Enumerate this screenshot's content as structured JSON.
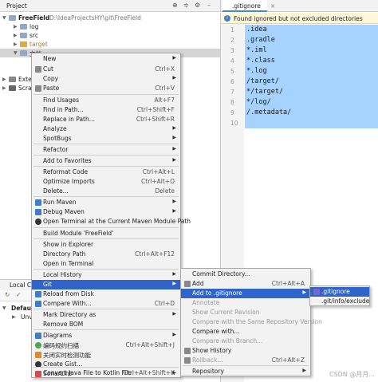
{
  "project_panel": {
    "title": "Project",
    "tree": [
      {
        "label": "FreeField",
        "path": "D:\\IdeaProjectsHY\\git\\FreeField"
      },
      {
        "label": "log"
      },
      {
        "label": "src"
      },
      {
        "label": "target"
      },
      {
        "label": "文档"
      },
      {
        "label": "Exte"
      },
      {
        "label": "Scra"
      }
    ]
  },
  "editor": {
    "tab_label": ".gitignore",
    "notice": "Found ignored but not excluded directories",
    "line_numbers": [
      "1",
      "2",
      "3",
      "4",
      "5",
      "6",
      "7",
      "8",
      "9",
      "10"
    ],
    "lines": [
      ".idea",
      ".gradle",
      "*.iml",
      "*.class",
      "*.log",
      "/target/",
      "*/target/",
      "*/log/",
      "/.metadata/",
      ""
    ]
  },
  "bottom_panel": {
    "tab": "Local Ch",
    "default_label": "Defaul",
    "unversioned": "Unv"
  },
  "context_menu": {
    "items": [
      {
        "label": "New",
        "shortcut": "",
        "submenu": true
      },
      {
        "label": "Cut",
        "shortcut": "Ctrl+X"
      },
      {
        "label": "Copy",
        "shortcut": "",
        "submenu": true
      },
      {
        "label": "Paste",
        "shortcut": "Ctrl+V"
      },
      {
        "label": "Find Usages",
        "shortcut": "Alt+F7"
      },
      {
        "label": "Find in Path...",
        "shortcut": "Ctrl+Shift+F"
      },
      {
        "label": "Replace in Path...",
        "shortcut": "Ctrl+Shift+R"
      },
      {
        "label": "Analyze",
        "shortcut": "",
        "submenu": true
      },
      {
        "label": "SpotBugs",
        "shortcut": "",
        "submenu": true
      },
      {
        "label": "Refactor",
        "shortcut": "",
        "submenu": true
      },
      {
        "label": "Add to Favorites",
        "shortcut": "",
        "submenu": true
      },
      {
        "label": "Reformat Code",
        "shortcut": "Ctrl+Alt+L"
      },
      {
        "label": "Optimize Imports",
        "shortcut": "Ctrl+Alt+O"
      },
      {
        "label": "Delete...",
        "shortcut": "Delete"
      },
      {
        "label": "Run Maven",
        "shortcut": "",
        "submenu": true
      },
      {
        "label": "Debug Maven",
        "shortcut": "",
        "submenu": true
      },
      {
        "label": "Open Terminal at the Current Maven Module Path",
        "shortcut": ""
      },
      {
        "label": "Build Module 'FreeField'",
        "shortcut": ""
      },
      {
        "label": "Show in Explorer",
        "shortcut": ""
      },
      {
        "label": "Directory Path",
        "shortcut": "Ctrl+Alt+F12"
      },
      {
        "label": "Open in Terminal",
        "shortcut": ""
      },
      {
        "label": "Local History",
        "shortcut": "",
        "submenu": true
      },
      {
        "label": "Git",
        "shortcut": "",
        "submenu": true
      },
      {
        "label": "Reload from Disk",
        "shortcut": ""
      },
      {
        "label": "Compare With...",
        "shortcut": "Ctrl+D"
      },
      {
        "label": "Mark Directory as",
        "shortcut": "",
        "submenu": true
      },
      {
        "label": "Remove BOM",
        "shortcut": ""
      },
      {
        "label": "Diagrams",
        "shortcut": "",
        "submenu": true
      },
      {
        "label": "编码规约扫描",
        "shortcut": "Ctrl+Alt+Shift+J"
      },
      {
        "label": "关闭实时检测功能",
        "shortcut": ""
      },
      {
        "label": "Create Gist...",
        "shortcut": ""
      },
      {
        "label": "SonarLint",
        "shortcut": "",
        "submenu": true
      },
      {
        "label": "Convert Java File to Kotlin File",
        "shortcut": "Ctrl+Alt+Shift+K"
      }
    ]
  },
  "git_submenu": {
    "items": [
      {
        "label": "Commit Directory...",
        "shortcut": ""
      },
      {
        "label": "Add",
        "shortcut": "Ctrl+Alt+A"
      },
      {
        "label": "Add to .gitignore",
        "shortcut": "",
        "submenu": true
      },
      {
        "label": "Annotate",
        "shortcut": ""
      },
      {
        "label": "Show Current Revision",
        "shortcut": ""
      },
      {
        "label": "Compare with the Same Repository Version",
        "shortcut": ""
      },
      {
        "label": "Compare with...",
        "shortcut": ""
      },
      {
        "label": "Compare with Branch...",
        "shortcut": ""
      },
      {
        "label": "Show History",
        "shortcut": ""
      },
      {
        "label": "Rollback...",
        "shortcut": "Ctrl+Alt+Z"
      },
      {
        "label": "Repository",
        "shortcut": "",
        "submenu": true
      }
    ]
  },
  "gitignore_submenu": {
    "items": [
      {
        "label": ".gitignore"
      },
      {
        "label": ".git/info/exclude"
      }
    ]
  },
  "submenu_arrow": "▶",
  "watermark": "CSDN @月月..."
}
